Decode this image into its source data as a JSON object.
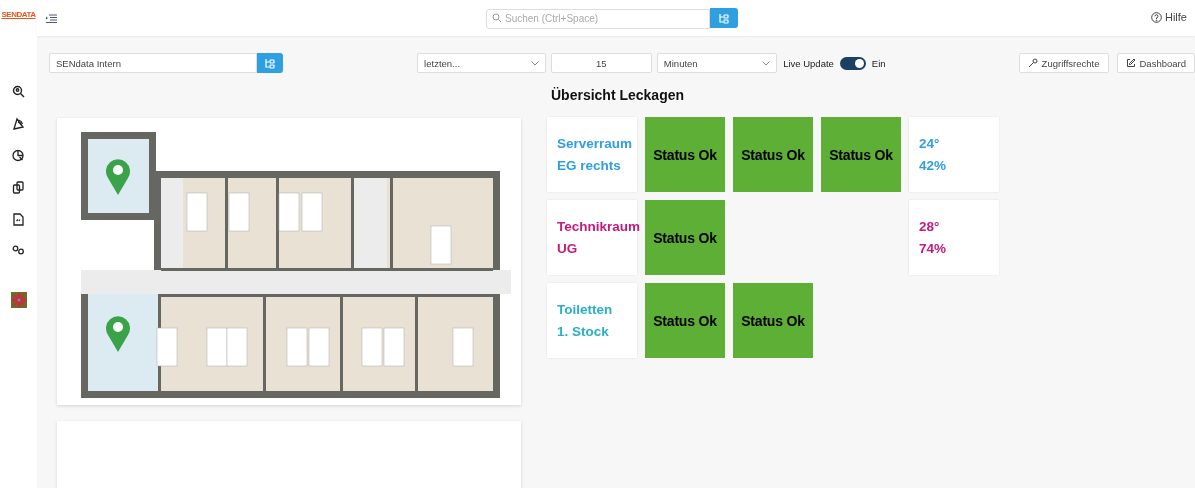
{
  "logo": {
    "text": "SENDATA"
  },
  "topbar": {
    "search": {
      "placeholder": "Suchen (Ctrl+Space)"
    },
    "help": "Hilfe"
  },
  "toolbar": {
    "location": {
      "value": "SENdata Intern"
    },
    "range": {
      "value": "letzten..."
    },
    "count": {
      "value": "15"
    },
    "unit": {
      "value": "Minuten"
    },
    "live_update": {
      "label": "Live Update",
      "on": true,
      "state_label": "Ein"
    },
    "buttons": [
      {
        "label": "Zugriffsrechte",
        "kind": "key"
      },
      {
        "label": "Dashboard",
        "kind": "edit"
      }
    ]
  },
  "title": "Übersicht Leckagen",
  "sensors": [
    {
      "name": [
        "Serverraum",
        "EG rechts"
      ],
      "color": "#2e9fe0",
      "statuses": [
        {
          "label": "Status Ok",
          "kind": "ok"
        },
        {
          "label": "Status Ok",
          "kind": "ok"
        },
        {
          "label": "Status Ok",
          "kind": "ok"
        }
      ],
      "readings": [
        "24°",
        "42%"
      ]
    },
    {
      "name": [
        "Technikraum",
        "UG"
      ],
      "color": "#c41a7c",
      "statuses": [
        {
          "label": "Status Ok",
          "kind": "ok"
        }
      ],
      "readings": [
        "28°",
        "74%"
      ]
    },
    {
      "name": [
        "Toiletten",
        "1. Stock"
      ],
      "color": "#29b0c6",
      "statuses": [
        {
          "label": "Status Ok",
          "kind": "ok"
        },
        {
          "label": "Status Ok",
          "kind": "ok"
        }
      ]
    }
  ]
}
